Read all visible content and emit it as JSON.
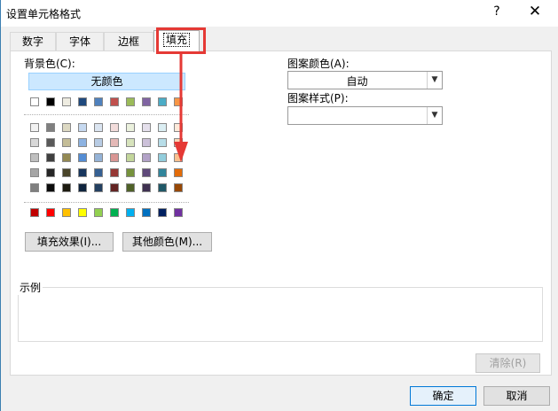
{
  "window": {
    "title": "设置单元格格式",
    "help": "?",
    "close": "✕"
  },
  "tabs": [
    {
      "label": "数字"
    },
    {
      "label": "字体"
    },
    {
      "label": "边框"
    },
    {
      "label": "填充"
    }
  ],
  "fill": {
    "background_label": "背景色(C):",
    "no_color_label": "无颜色",
    "pattern_color_label": "图案颜色(A):",
    "pattern_color_value": "自动",
    "pattern_style_label": "图案样式(P):",
    "pattern_style_value": "",
    "fill_effects_button": "填充效果(I)...",
    "more_colors_button": "其他颜色(M)...",
    "sample_label": "示例",
    "clear_button": "清除(R)"
  },
  "buttons": {
    "ok": "确定",
    "cancel": "取消"
  },
  "palette": {
    "theme_top": [
      "#ffffff",
      "#000000",
      "#eeece1",
      "#1f497d",
      "#4f81bd",
      "#c0504d",
      "#9bbb59",
      "#8064a2",
      "#4bacc6",
      "#f79646"
    ],
    "theme_shades": [
      [
        "#f2f2f2",
        "#7f7f7f",
        "#ddd9c3",
        "#c6d9f0",
        "#dbe5f1",
        "#f2dcdb",
        "#ebf1dd",
        "#e5e0ec",
        "#dbeef3",
        "#fdeada"
      ],
      [
        "#d8d8d8",
        "#595959",
        "#c4bd97",
        "#8db3e2",
        "#b8cce4",
        "#e5b9b7",
        "#d7e3bc",
        "#ccc1d9",
        "#b7dde8",
        "#fbd5b5"
      ],
      [
        "#bfbfbf",
        "#3f3f3f",
        "#938953",
        "#548dd4",
        "#95b3d7",
        "#d99694",
        "#c3d69b",
        "#b2a2c7",
        "#92cddc",
        "#fac08f"
      ],
      [
        "#a5a5a5",
        "#262626",
        "#494429",
        "#17365d",
        "#366092",
        "#953734",
        "#76923c",
        "#5f497a",
        "#31859b",
        "#e36c09"
      ],
      [
        "#7f7f7f",
        "#0c0c0c",
        "#1d1b10",
        "#0f243e",
        "#244061",
        "#632423",
        "#4f6128",
        "#3f3151",
        "#205867",
        "#974806"
      ]
    ],
    "standard": [
      "#c00000",
      "#ff0000",
      "#ffc000",
      "#ffff00",
      "#92d050",
      "#00b050",
      "#00b0f0",
      "#0070c0",
      "#002060",
      "#7030a0"
    ]
  },
  "annotation": {
    "color": "#e53935"
  }
}
